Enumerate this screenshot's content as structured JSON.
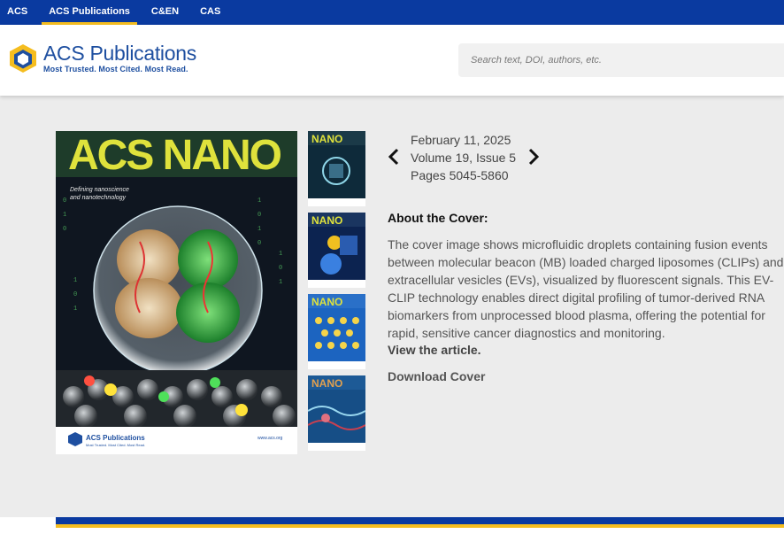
{
  "topnav": {
    "items": [
      {
        "label": "ACS"
      },
      {
        "label": "ACS Publications"
      },
      {
        "label": "C&EN"
      },
      {
        "label": "CAS"
      }
    ]
  },
  "header": {
    "logo_title": "ACS Publications",
    "logo_tagline": "Most Trusted. Most Cited. Most Read.",
    "search_placeholder": "Search text, DOI, authors, etc."
  },
  "cover": {
    "journal": "ACS NANO",
    "subtitle": "Defining nanoscience and nanotechnology",
    "publisher": "ACS Publications",
    "publisher_tag": "Most Trusted. Most Cited. Most Read.",
    "url": "www.acs.org"
  },
  "issue": {
    "date": "February 11, 2025",
    "volume_issue": "Volume 19, Issue 5",
    "pages": "Pages 5045-5860"
  },
  "about": {
    "heading": "About the Cover:",
    "body": "The cover image shows microfluidic droplets containing fusion events between molecular beacon (MB) loaded charged liposomes (CLIPs) and extracellular vesicles (EVs), visualized by fluorescent signals. This EV-CLIP technology enables direct digital profiling of tumor-derived RNA biomarkers from unprocessed blood plasma, offering the potential for rapid, sensitive cancer diagnostics and monitoring.",
    "view_link": "View the article.",
    "download": "Download Cover"
  },
  "colors": {
    "brand_blue": "#0a3aa0",
    "accent_gold": "#f5bd1f",
    "background_grey": "#ececec"
  }
}
